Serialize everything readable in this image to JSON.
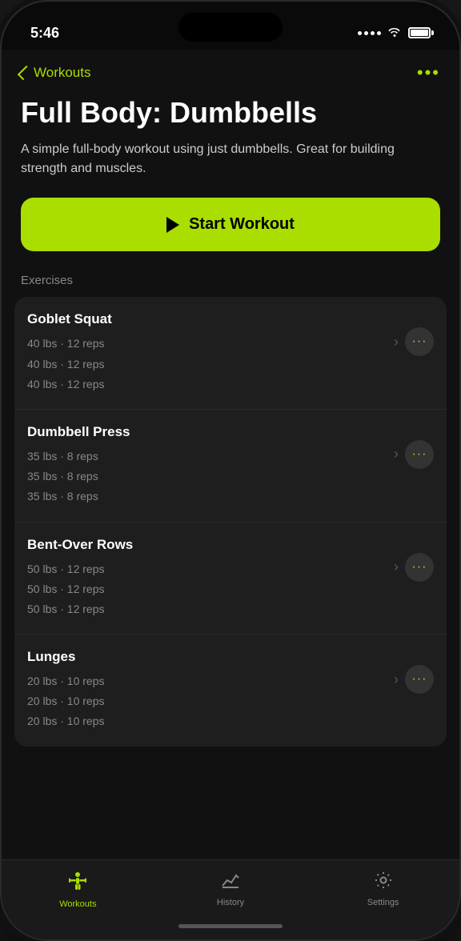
{
  "status": {
    "time": "5:46"
  },
  "header": {
    "back_label": "Workouts",
    "more_label": "•••"
  },
  "hero": {
    "title": "Full Body: Dumbbells",
    "description": "A simple full-body workout using just dumbbells. Great for building strength and muscles.",
    "start_button_label": "Start Workout"
  },
  "exercises_section_label": "Exercises",
  "exercises": [
    {
      "name": "Goblet Squat",
      "sets": [
        "40 lbs · 12 reps",
        "40 lbs · 12 reps",
        "40 lbs · 12 reps"
      ]
    },
    {
      "name": "Dumbbell Press",
      "sets": [
        "35 lbs · 8 reps",
        "35 lbs · 8 reps",
        "35 lbs · 8 reps"
      ]
    },
    {
      "name": "Bent-Over Rows",
      "sets": [
        "50 lbs · 12 reps",
        "50 lbs · 12 reps",
        "50 lbs · 12 reps"
      ]
    },
    {
      "name": "Lunges",
      "sets": [
        "20 lbs · 10 reps",
        "20 lbs · 10 reps",
        "20 lbs · 10 reps"
      ]
    }
  ],
  "tabs": [
    {
      "id": "workouts",
      "label": "Workouts",
      "active": true
    },
    {
      "id": "history",
      "label": "History",
      "active": false
    },
    {
      "id": "settings",
      "label": "Settings",
      "active": false
    }
  ],
  "colors": {
    "accent": "#aadd00",
    "bg": "#111",
    "card": "#1e1e1e",
    "text_primary": "#ffffff",
    "text_secondary": "#888888"
  }
}
